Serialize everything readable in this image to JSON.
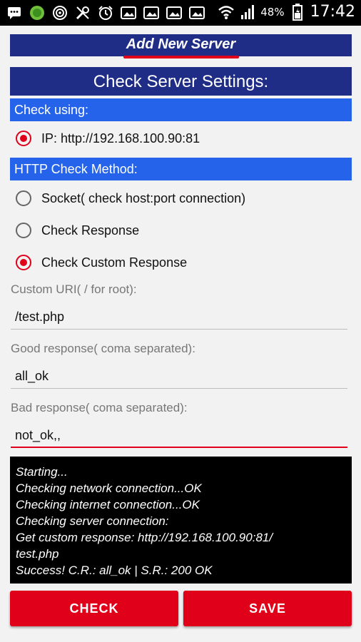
{
  "status_bar": {
    "battery_percent": "48%",
    "time": "17:42",
    "icons": [
      "chat-icon",
      "circle-app-icon",
      "target-icon",
      "tools-icon",
      "alarm-icon",
      "gallery-icon",
      "gallery-icon",
      "gallery-icon",
      "gallery-icon",
      "wifi-icon",
      "signal-icon",
      "battery-icon"
    ]
  },
  "top_bar": {
    "title": "Add New Server"
  },
  "header": {
    "title": "Check Server Settings:"
  },
  "check_using": {
    "title": "Check using:",
    "options": [
      {
        "label": "IP: http://192.168.100.90:81",
        "checked": true
      }
    ]
  },
  "http_method": {
    "title": "HTTP Check Method:",
    "options": [
      {
        "label": "Socket( check host:port connection)",
        "checked": false
      },
      {
        "label": "Check Response",
        "checked": false
      },
      {
        "label": "Check Custom Response",
        "checked": true
      }
    ]
  },
  "fields": {
    "custom_uri": {
      "label": "Custom URI( / for root):",
      "value": "/test.php"
    },
    "good_response": {
      "label": "Good response( coma separated):",
      "value": "all_ok"
    },
    "bad_response": {
      "label": "Bad response( coma separated):",
      "value": "not_ok,,"
    }
  },
  "log": {
    "lines": [
      "Starting...",
      "Checking network connection...OK",
      "Checking internet connection...OK",
      "Checking server connection:",
      "Get custom response: http://192.168.100.90:81/",
      "test.php",
      "Success! C.R.: all_ok | S.R.: 200 OK"
    ]
  },
  "buttons": {
    "check": "CHECK",
    "save": "SAVE"
  },
  "colors": {
    "accent": "#e0001a",
    "navy": "#1f2d86",
    "section_blue": "#2563ea"
  }
}
